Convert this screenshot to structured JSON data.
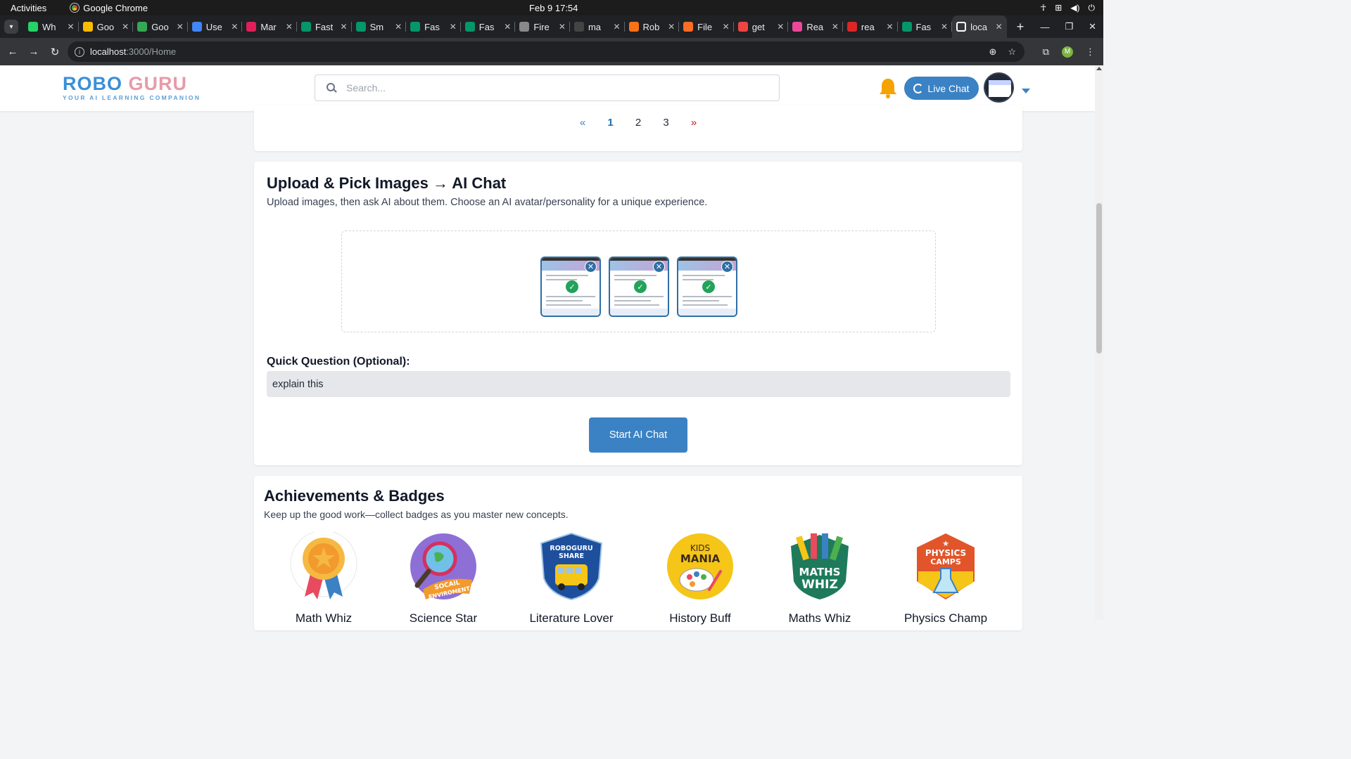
{
  "os": {
    "activities": "Activities",
    "app_name": "Google Chrome",
    "clock": "Feb 9  17:54"
  },
  "tabs": [
    {
      "title": "Wh",
      "color": "#25d366"
    },
    {
      "title": "Goo",
      "color": "#fbbc05"
    },
    {
      "title": "Goo",
      "color": "#34a853"
    },
    {
      "title": "Use",
      "color": "#4285f4"
    },
    {
      "title": "Mar",
      "color": "#e01e5a"
    },
    {
      "title": "Fast",
      "color": "#059669"
    },
    {
      "title": "Sm",
      "color": "#059669"
    },
    {
      "title": "Fas",
      "color": "#059669"
    },
    {
      "title": "Fas",
      "color": "#059669"
    },
    {
      "title": "Fire",
      "color": "#888888"
    },
    {
      "title": "ma",
      "color": "#444444"
    },
    {
      "title": "Rob",
      "color": "#f97316"
    },
    {
      "title": "File",
      "color": "#fc6d26"
    },
    {
      "title": "get",
      "color": "#ef4444"
    },
    {
      "title": "Rea",
      "color": "#ec4899"
    },
    {
      "title": "rea",
      "color": "#dc2626"
    },
    {
      "title": "Fas",
      "color": "#059669"
    },
    {
      "title": "loca",
      "color": "#ffffff",
      "active": true
    }
  ],
  "address": {
    "host": "localhost",
    "path": ":3000/Home"
  },
  "header": {
    "logo_part1": "ROBO ",
    "logo_part2": "GURU",
    "tagline": "YOUR AI LEARNING COMPANION",
    "search_placeholder": "Search...",
    "live_chat_label": "Live Chat"
  },
  "pagination": {
    "prev": "«",
    "pages": [
      "1",
      "2",
      "3"
    ],
    "current": "1",
    "next": "»"
  },
  "upload": {
    "title": "Upload & Pick Images → AI Chat",
    "subtitle": "Upload images, then ask AI about them. Choose an AI avatar/personality for a unique experience.",
    "images_selected": 3,
    "question_label": "Quick Question (Optional):",
    "question_value": "explain this ",
    "start_label": "Start AI Chat"
  },
  "badges": {
    "title": "Achievements & Badges",
    "subtitle": "Keep up the good work—collect badges as you master new concepts.",
    "items": [
      {
        "name": "Math Whiz",
        "art_text": ""
      },
      {
        "name": "Science Star",
        "art_text": "SOCAIL ENVIROMENT"
      },
      {
        "name": "Literature Lover",
        "art_text": "ROBOGURU SHARE"
      },
      {
        "name": "History Buff",
        "art_text": "KIDS MANIA"
      },
      {
        "name": "Maths Whiz",
        "art_text": "MATHS WHIZ"
      },
      {
        "name": "Physics Champ",
        "art_text": "PHYSICS CAMPS"
      }
    ]
  },
  "colors": {
    "brand_blue": "#3b82c4",
    "logo_blue": "#3b8fd6",
    "logo_pink": "#e89aa8",
    "check_green": "#22a35a"
  }
}
